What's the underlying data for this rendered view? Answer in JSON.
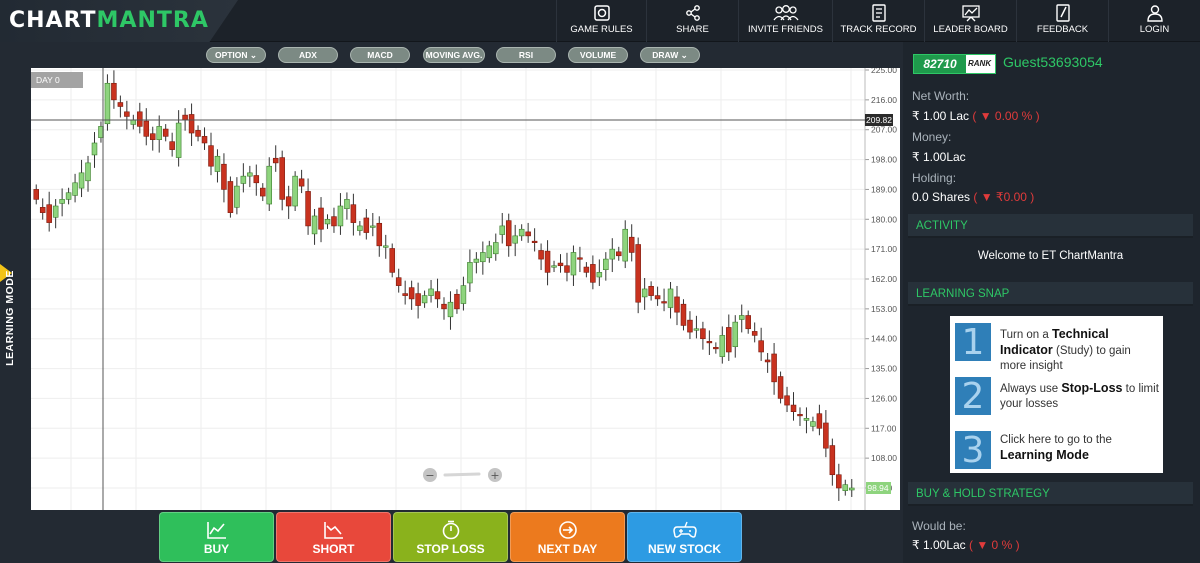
{
  "logo": {
    "part1": "CHART",
    "part2": "MANTRA"
  },
  "nav": [
    {
      "label": "GAME RULES",
      "icon": "game-rules-icon"
    },
    {
      "label": "SHARE",
      "icon": "share-icon"
    },
    {
      "label": "INVITE FRIENDS",
      "icon": "invite-friends-icon"
    },
    {
      "label": "TRACK RECORD",
      "icon": "track-record-icon"
    },
    {
      "label": "LEADER BOARD",
      "icon": "leader-board-icon"
    },
    {
      "label": "FEEDBACK",
      "icon": "feedback-icon"
    },
    {
      "label": "LOGIN",
      "icon": "login-icon"
    }
  ],
  "learning_mode": "LEARNING MODE",
  "indicators": [
    "OPTION ⌄",
    "ADX",
    "MACD",
    "MOVING AVG.",
    "RSI",
    "VOLUME",
    "DRAW ⌄"
  ],
  "chart": {
    "day_label": "DAY 0",
    "crosshair_value": "209.82",
    "last_price": "98.94",
    "zoom_minus": "−",
    "zoom_plus": "+"
  },
  "chart_data": {
    "type": "candlestick",
    "y_ticks": [
      "225.00",
      "216.00",
      "207.00",
      "198.00",
      "189.00",
      "180.00",
      "171.00",
      "162.00",
      "153.00",
      "144.00",
      "135.00",
      "126.00",
      "117.00",
      "108.00",
      "99.00"
    ],
    "ylim": [
      99,
      225
    ],
    "colors": {
      "up": "#8ed47e",
      "down": "#c8321f",
      "up_border": "#3c7d2c",
      "down_border": "#7a1a0e"
    },
    "closes": [
      186,
      182,
      179,
      184,
      186,
      188,
      191,
      194,
      197,
      203,
      208,
      221,
      216,
      214,
      211,
      210,
      208,
      205,
      204,
      208,
      205,
      201,
      209,
      210,
      206,
      205,
      203,
      196,
      199,
      189,
      182,
      190,
      193,
      194,
      191,
      187,
      196,
      197,
      186,
      184,
      193,
      190,
      178,
      181,
      177,
      180,
      178,
      184,
      186,
      179,
      178,
      176,
      178,
      172,
      172,
      164,
      160,
      157,
      156,
      154,
      157,
      159,
      156,
      153,
      155,
      153,
      160,
      167,
      168,
      170,
      172,
      173,
      178,
      172,
      175,
      177,
      175,
      173,
      168,
      164,
      166,
      166,
      164,
      170,
      168,
      164,
      161,
      164,
      168,
      171,
      169,
      177,
      170,
      155,
      159,
      157,
      156,
      155,
      159,
      152,
      148,
      146,
      147,
      144,
      143,
      141,
      145,
      140,
      149,
      151,
      147,
      145,
      140,
      137,
      131,
      126,
      124,
      122,
      121,
      120,
      119,
      117,
      111,
      103,
      99,
      100,
      99
    ]
  },
  "actions": [
    {
      "label": "BUY",
      "color": "#2fbf5b",
      "icon": "buy-chart-icon"
    },
    {
      "label": "SHORT",
      "color": "#e8483b",
      "icon": "short-chart-icon"
    },
    {
      "label": "STOP LOSS",
      "color": "#8ab21c",
      "icon": "stopwatch-icon"
    },
    {
      "label": "NEXT DAY",
      "color": "#ec7a1e",
      "icon": "next-arrow-icon"
    },
    {
      "label": "NEW STOCK",
      "color": "#2d9be3",
      "icon": "gamepad-icon"
    }
  ],
  "panel": {
    "rank_number": "82710",
    "rank_label": "RANK",
    "guest": "Guest53693054",
    "net_worth_label": "Net Worth:",
    "net_worth_value": "₹ 1.00 Lac",
    "net_worth_change": "( ▼ 0.00 % )",
    "money_label": "Money:",
    "money_value": "₹ 1.00Lac",
    "holding_label": "Holding:",
    "holding_value": "0.0 Shares",
    "holding_change": "( ▼ ₹0.00 )",
    "activity_title": "ACTIVITY",
    "welcome": "Welcome to ET ChartMantra",
    "snap_title": "LEARNING SNAP",
    "snap_items": [
      {
        "num": "1",
        "pre": "Turn on a ",
        "bold": "Technical Indicator",
        "post": " (Study) to gain more insight"
      },
      {
        "num": "2",
        "pre": "Always use ",
        "bold": "Stop-Loss",
        "post": " to limit your losses"
      },
      {
        "num": "3",
        "pre": "Click here to go to the ",
        "bold": "Learning Mode",
        "post": ""
      }
    ],
    "bh_title": "BUY & HOLD STRATEGY",
    "would_be_label": "Would be:",
    "would_be_value": "₹  1.00Lac",
    "would_be_change": "( ▼ 0 % )"
  }
}
